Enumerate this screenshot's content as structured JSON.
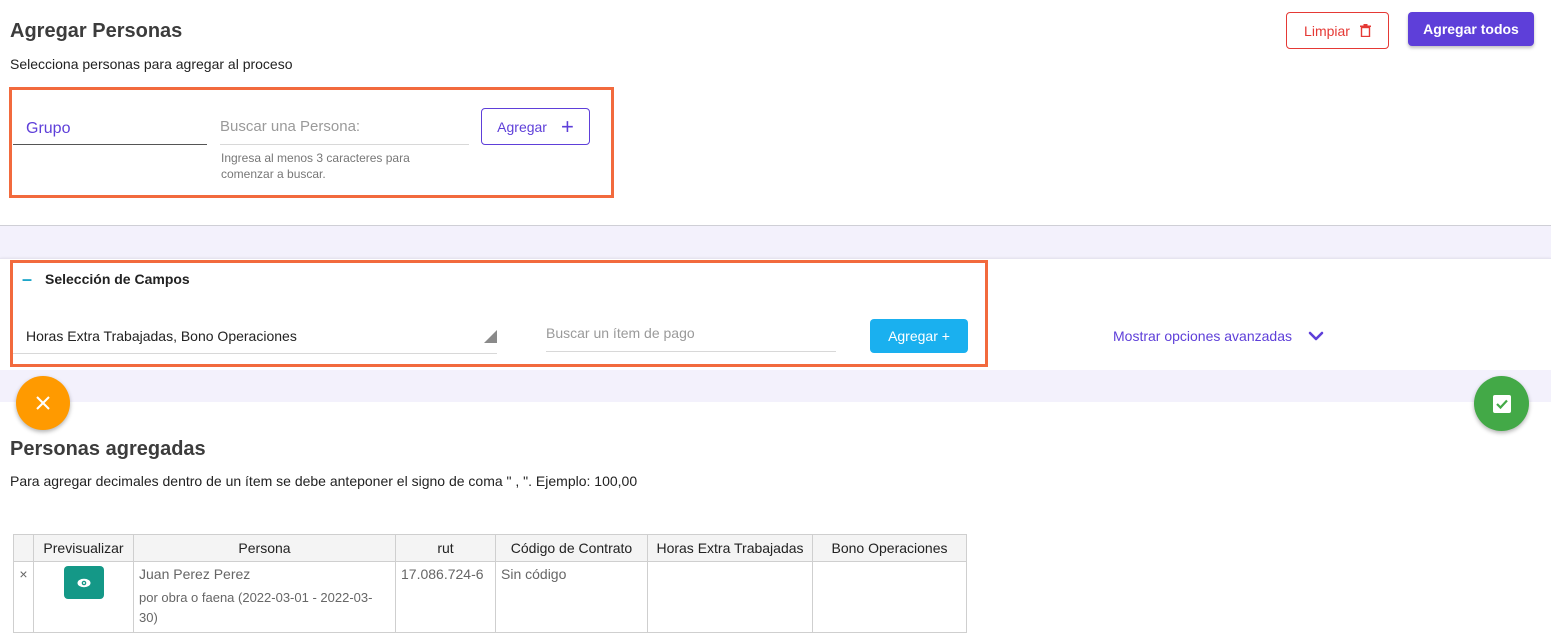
{
  "header": {
    "title": "Agregar Personas",
    "subtitle": "Selecciona personas para agregar al proceso",
    "clear_label": "Limpiar",
    "add_all_label": "Agregar todos"
  },
  "search_person": {
    "group_value": "Grupo",
    "placeholder": "Buscar una Persona:",
    "hint": "Ingresa al menos 3 caracteres para comenzar a buscar.",
    "add_label": "Agregar",
    "add_icon": "+"
  },
  "fields_section": {
    "toggle": "–",
    "title": "Selección de Campos",
    "selected_fields": "Horas Extra Trabajadas, Bono Operaciones",
    "item_placeholder": "Buscar un ítem de pago",
    "add_label": "Agregar +",
    "advanced_label": "Mostrar opciones avanzadas"
  },
  "added": {
    "title": "Personas agregadas",
    "note": "Para agregar decimales dentro de un ítem se debe anteponer el signo de coma \" , \". Ejemplo: 100,00"
  },
  "table": {
    "columns": [
      "",
      "Previsualizar",
      "Persona",
      "rut",
      "Código de Contrato",
      "Horas Extra Trabajadas",
      "Bono Operaciones"
    ],
    "rows": [
      {
        "remove": "×",
        "person_name": "Juan Perez Perez",
        "contract_desc": "por obra o faena (2022-03-01 - 2022-03-30)",
        "rut": "17.086.724-6",
        "contract_code": "Sin código",
        "horas_extra": "",
        "bono": ""
      }
    ]
  },
  "colors": {
    "primary": "#5e3fd9",
    "danger": "#e53935",
    "info": "#1ab0ef",
    "warning": "#ff9a00",
    "success": "#43a947",
    "teal": "#149887",
    "highlight": "#f26a3d"
  },
  "icons": {
    "clear": "trash-icon",
    "fab_left": "close-icon",
    "fab_right": "checkbox-checked-icon",
    "preview": "eye-icon",
    "advanced": "chevron-down-icon"
  }
}
